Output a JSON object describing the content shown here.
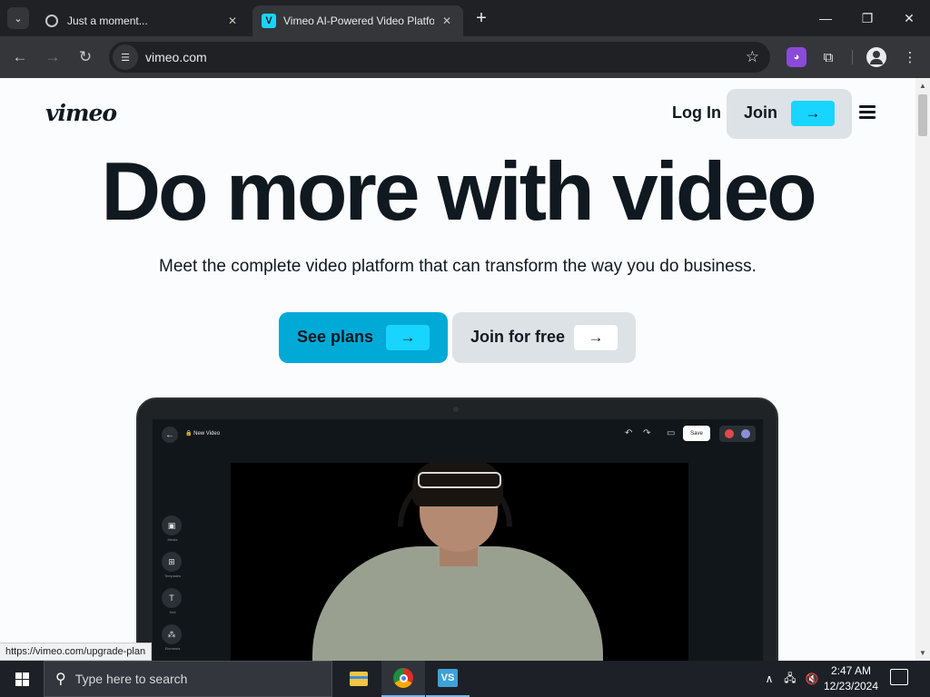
{
  "browser": {
    "tabs": [
      {
        "title": "Just a moment...",
        "icon": "globe-icon"
      },
      {
        "title": "Vimeo AI-Powered Video Platfo",
        "icon": "vimeo-favicon",
        "active": true
      }
    ],
    "favicon_letter": "V",
    "url": "vimeo.com",
    "status_url": "https://vimeo.com/upgrade-plan",
    "accent": "#17d5ff"
  },
  "page": {
    "logo": "vimeo",
    "login": "Log In",
    "join": "Join",
    "headline": "Do more with video",
    "subheadline": "Meet the complete video platform that can transform the way you do business.",
    "cta_plans": "See plans",
    "cta_free": "Join for free",
    "arrow": "→"
  },
  "editor": {
    "project_title": "New Video",
    "save": "Save",
    "tools": [
      "Media",
      "Templates",
      "Text",
      "Elements"
    ]
  },
  "taskbar": {
    "search_placeholder": "Type here to search",
    "time": "2:47 AM",
    "date": "12/23/2024"
  }
}
